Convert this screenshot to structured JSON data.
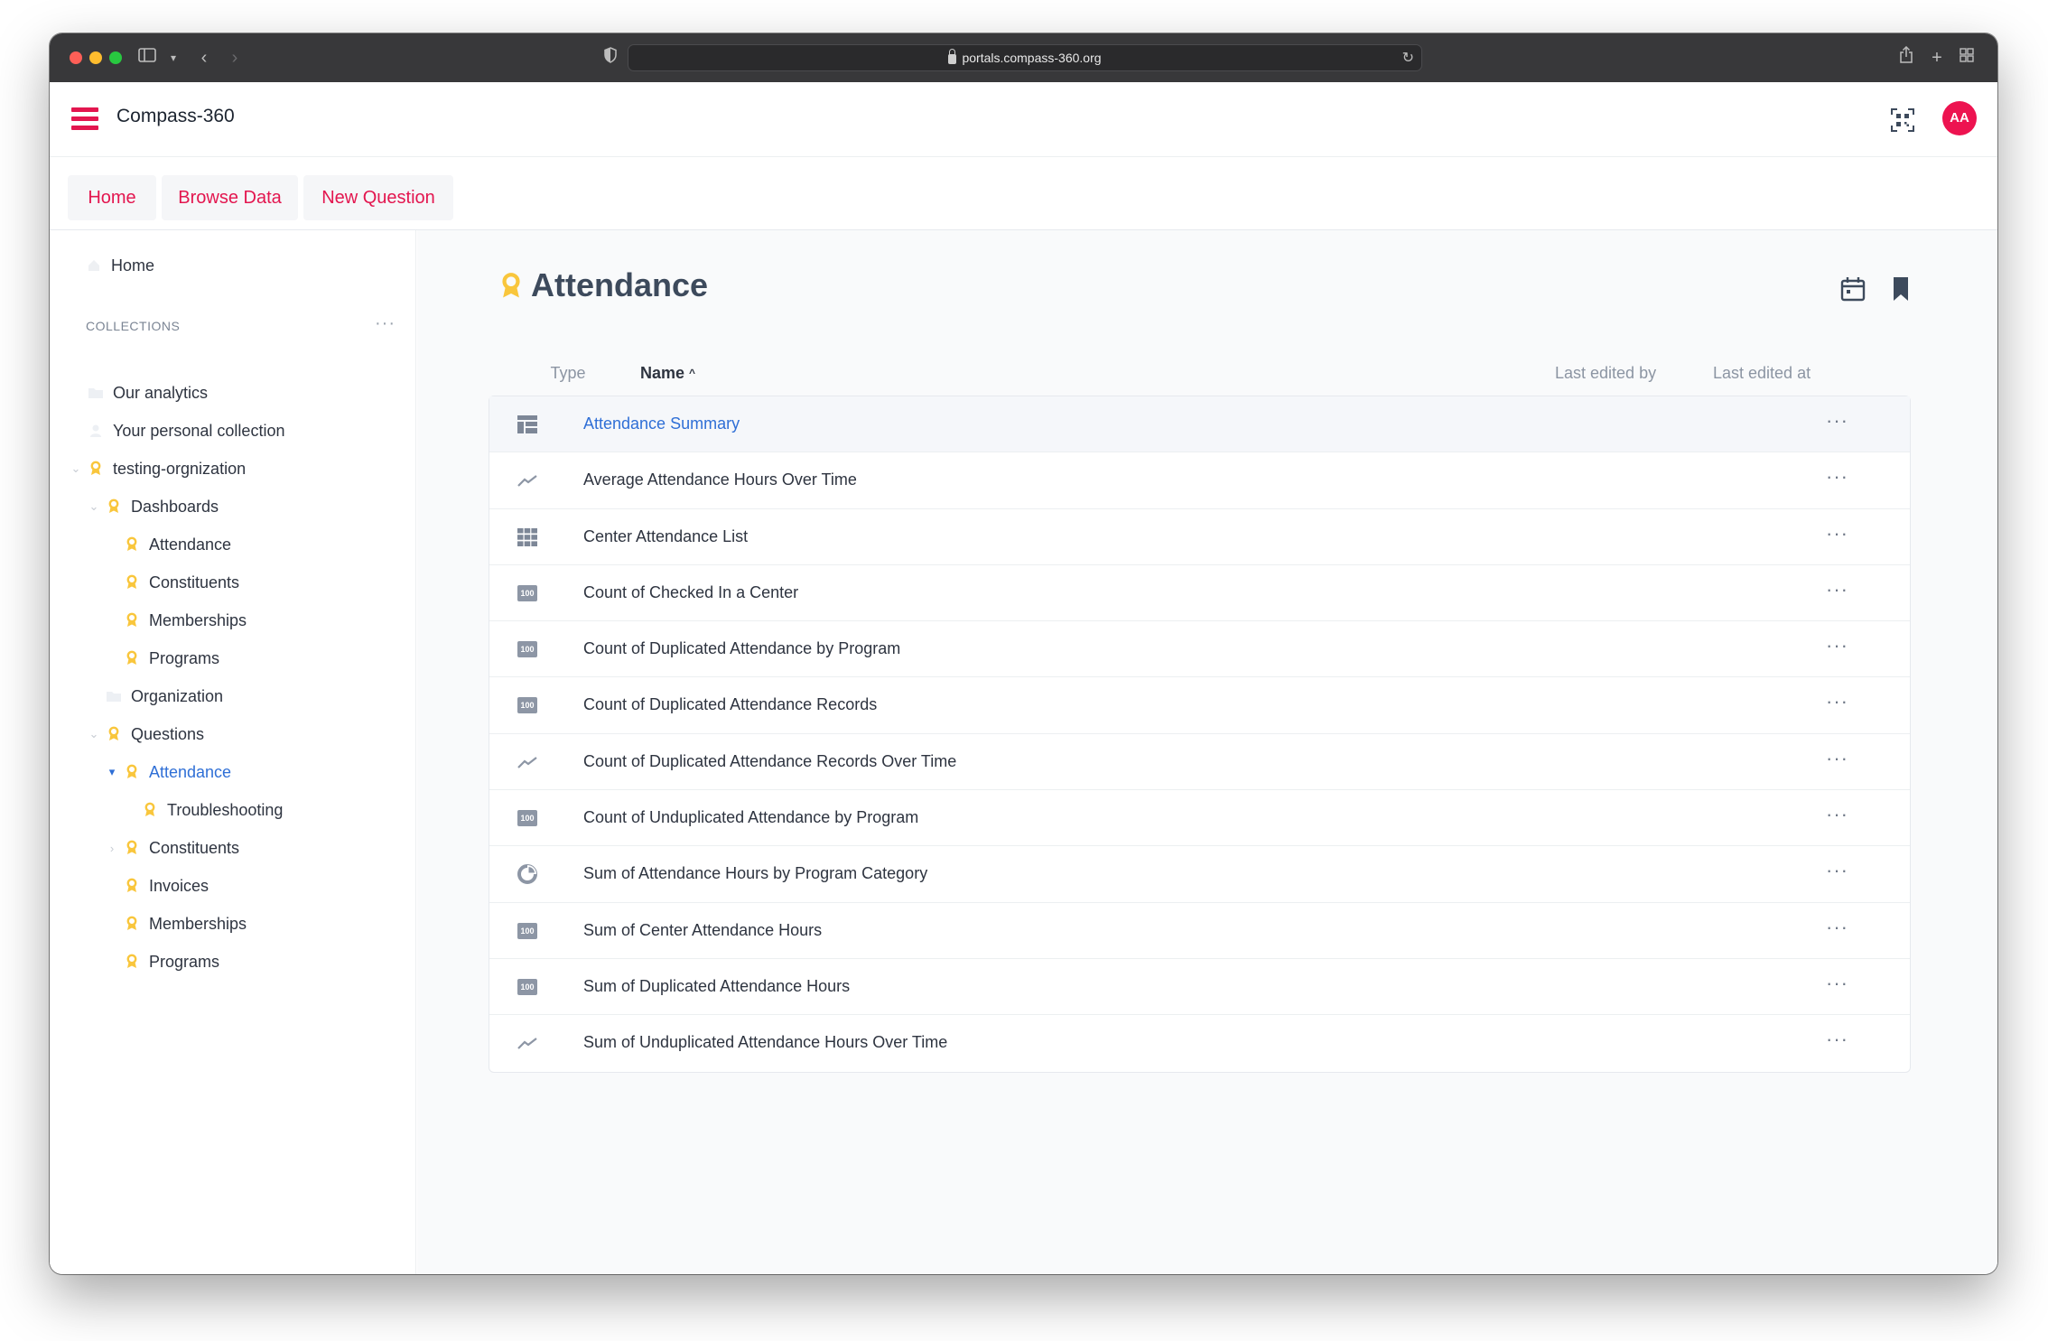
{
  "browser": {
    "url": "portals.compass-360.org"
  },
  "header": {
    "app_title": "Compass-360",
    "avatar_initials": "AA",
    "accent_color": "#e3164f"
  },
  "nav": {
    "tabs": [
      {
        "label": "Home"
      },
      {
        "label": "Browse Data"
      },
      {
        "label": "New Question"
      }
    ]
  },
  "sidebar": {
    "home_label": "Home",
    "collections_label": "COLLECTIONS",
    "items": [
      {
        "label": "Our analytics",
        "icon": "folder-icon",
        "level": 0
      },
      {
        "label": "Your personal collection",
        "icon": "person-icon",
        "level": 0
      },
      {
        "label": "testing-orgnization",
        "icon": "badge-icon",
        "level": 0
      },
      {
        "label": "Dashboards",
        "icon": "badge-icon",
        "level": 1
      },
      {
        "label": "Attendance",
        "icon": "badge-icon",
        "level": 2
      },
      {
        "label": "Constituents",
        "icon": "badge-icon",
        "level": 2
      },
      {
        "label": "Memberships",
        "icon": "badge-icon",
        "level": 2
      },
      {
        "label": "Programs",
        "icon": "badge-icon",
        "level": 2
      },
      {
        "label": "Organization",
        "icon": "folder-icon",
        "level": 1
      },
      {
        "label": "Questions",
        "icon": "badge-icon",
        "level": 1
      },
      {
        "label": "Attendance",
        "icon": "badge-icon",
        "level": 2,
        "active": true
      },
      {
        "label": "Troubleshooting",
        "icon": "badge-icon",
        "level": 3
      },
      {
        "label": "Constituents",
        "icon": "badge-icon",
        "level": 2
      },
      {
        "label": "Invoices",
        "icon": "badge-icon",
        "level": 2
      },
      {
        "label": "Memberships",
        "icon": "badge-icon",
        "level": 2
      },
      {
        "label": "Programs",
        "icon": "badge-icon",
        "level": 2
      }
    ]
  },
  "main": {
    "title": "Attendance",
    "columns": {
      "type": "Type",
      "name": "Name",
      "last_edited_by": "Last edited by",
      "last_edited_at": "Last edited at"
    },
    "rows": [
      {
        "name": "Attendance Summary",
        "type_icon": "dashboard-icon",
        "highlight": true
      },
      {
        "name": "Average Attendance Hours Over Time",
        "type_icon": "line-chart-icon"
      },
      {
        "name": "Center Attendance List",
        "type_icon": "table-icon"
      },
      {
        "name": "Count of Checked In a Center",
        "type_icon": "number-icon"
      },
      {
        "name": "Count of Duplicated Attendance by Program",
        "type_icon": "number-icon"
      },
      {
        "name": "Count of Duplicated Attendance Records",
        "type_icon": "number-icon"
      },
      {
        "name": "Count of Duplicated Attendance Records Over Time",
        "type_icon": "line-chart-icon"
      },
      {
        "name": "Count of Unduplicated Attendance by Program",
        "type_icon": "number-icon"
      },
      {
        "name": "Sum of Attendance Hours by Program Category",
        "type_icon": "pie-chart-icon"
      },
      {
        "name": "Sum of Center Attendance Hours",
        "type_icon": "number-icon"
      },
      {
        "name": "Sum of Duplicated Attendance Hours",
        "type_icon": "number-icon"
      },
      {
        "name": "Sum of Unduplicated Attendance Hours Over Time",
        "type_icon": "line-chart-icon"
      }
    ],
    "number_icon_text": "100"
  }
}
